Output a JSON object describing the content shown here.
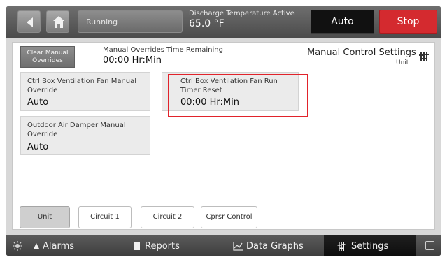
{
  "header": {
    "status_text": "Running",
    "discharge_label": "Discharge Temperature Active",
    "discharge_value": "65.0 °F",
    "auto_label": "Auto",
    "stop_label": "Stop"
  },
  "content": {
    "clear_button": "Clear Manual Overrides",
    "overrides_label": "Manual Overrides Time Remaining",
    "overrides_value": "00:00 Hr:Min",
    "settings_title": "Manual Control Settings",
    "settings_sub": "Unit",
    "cards": [
      {
        "title": "Ctrl Box Ventilation Fan Manual Override",
        "value": "Auto"
      },
      {
        "title": "Ctrl Box Ventilation Fan Run Timer Reset",
        "value": "00:00 Hr:Min"
      },
      {
        "title": "Outdoor Air Damper Manual Override",
        "value": "Auto"
      }
    ],
    "tabs": [
      "Unit",
      "Circuit 1",
      "Circuit 2",
      "Cprsr Control"
    ]
  },
  "footer": {
    "alarms": "Alarms",
    "reports": "Reports",
    "data_graphs": "Data Graphs",
    "settings": "Settings"
  },
  "icons": {
    "back": "chevron-left-icon",
    "home": "home-icon",
    "settings_sliders": "sliders-icon",
    "brightness": "sun-icon",
    "alarm": "bell-icon",
    "report": "document-icon",
    "graph": "line-graph-icon",
    "chat": "chat-icon"
  },
  "colors": {
    "stop": "#d42a2f",
    "auto": "#111111",
    "highlight": "#e1232b"
  }
}
